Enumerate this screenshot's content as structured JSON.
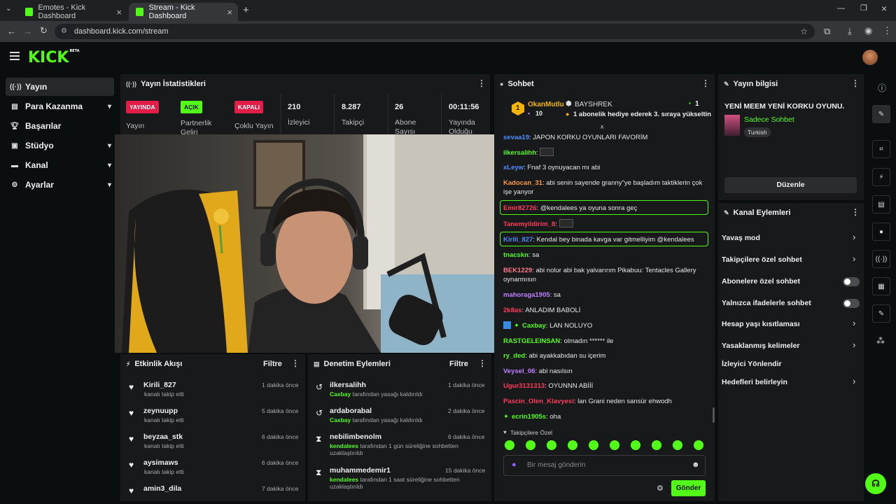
{
  "browser": {
    "tabs": [
      {
        "title": "Emotes - Kick Dashboard"
      },
      {
        "title": "Stream - Kick Dashboard"
      }
    ],
    "url": "dashboard.kick.com/stream"
  },
  "header": {
    "logo": "KICK",
    "logo_sup": "BETA"
  },
  "nav": [
    {
      "label": "Yayın",
      "icon": "broadcast-icon",
      "active": true
    },
    {
      "label": "Para Kazanma",
      "icon": "wallet-icon"
    },
    {
      "label": "Başarılar",
      "icon": "trophy-icon"
    },
    {
      "label": "Stüdyo",
      "icon": "studio-icon"
    },
    {
      "label": "Kanal",
      "icon": "channel-icon"
    },
    {
      "label": "Ayarlar",
      "icon": "gear-icon"
    }
  ],
  "stats": {
    "title": "Yayın İstatistikleri",
    "items": [
      {
        "badge": "YAYINDA",
        "label": "Yayın"
      },
      {
        "badge": "AÇIK",
        "label": "Partnerlik Geliri"
      },
      {
        "badge": "KAPALI",
        "label": "Çoklu Yayın"
      },
      {
        "value": "210",
        "label": "İzleyici"
      },
      {
        "value": "8.287",
        "label": "Takipçi"
      },
      {
        "value": "26",
        "label": "Abone Sayısı"
      },
      {
        "value": "00:11:56",
        "label": "Yayında Olduğu"
      }
    ]
  },
  "chat": {
    "title": "Sohbet",
    "pinned": {
      "user": "OkanMutlu",
      "count": "10",
      "channel": "BAYSHREK",
      "text": "1 abonelik hediye ederek 3. sıraya yükseltin",
      "rank": "1",
      "green_count": "1"
    },
    "messages": [
      {
        "user": "sevaa19",
        "color": "#4d8dff",
        "text": "JAPON KORKU OYUNLARI FAVORİM"
      },
      {
        "user": "ilkersalihh",
        "color": "#53fc18",
        "text": ""
      },
      {
        "user": "xLeyw",
        "color": "#4d8dff",
        "text": "Fnaf 3 oynuyacan mı abi"
      },
      {
        "user": "Kadocan_31",
        "color": "#ff9a3c",
        "text": "abi senin sayende granny\"ye başladım taktiklerin çok işe yanyor"
      },
      {
        "user": "Emir82726",
        "color": "#ff3b5b",
        "text": "@kendalees ya oyuna sonra geç"
      },
      {
        "user": "Tanemyildirim_8",
        "color": "#ff3b5b",
        "text": ""
      },
      {
        "user": "Kirili_827",
        "color": "#4d8dff",
        "text": "Kendal bey binada kavga var gitmelliyim @kendalees"
      },
      {
        "user": "tnacskn",
        "color": "#53fc18",
        "text": "sa"
      },
      {
        "user": "BEK1229",
        "color": "#ff7a8a",
        "text": "abi nolur abi bak yalvarırım Pikabuu: Tentacles Gallery oynarmısın"
      },
      {
        "user": "mahoraga1905",
        "color": "#c080ff",
        "text": "sa"
      },
      {
        "user": "2k8as",
        "color": "#ff3b5b",
        "text": "ANLADIM BABOLİ"
      },
      {
        "user": "Caxbay",
        "color": "#53fc18",
        "text": "LAN NOLUYO"
      },
      {
        "user": "RASTGELEINSAN",
        "color": "#53fc18",
        "text": "olmadın ****** ile"
      },
      {
        "user": "ry_ded",
        "color": "#53fc18",
        "text": "abi ayakkabıdan su içerim"
      },
      {
        "user": "Veysel_06",
        "color": "#c080ff",
        "text": "abi nasılsın"
      },
      {
        "user": "Ugur3131313",
        "color": "#ff3b5b",
        "text": "OYUNNN ABİİİ"
      },
      {
        "user": "Pascin_Olen_Klavyesi",
        "color": "#ff3b5b",
        "text": "lan Grani neden sansür ehwodh"
      },
      {
        "user": "ecrin1905s",
        "color": "#53fc18",
        "text": "oha"
      }
    ],
    "followers_only": "Takipçilere Özel",
    "placeholder": "Bir mesaj gönderin",
    "send": "Gönder"
  },
  "activity": {
    "title": "Etkinlik Akışı",
    "filter": "Filtre",
    "items": [
      {
        "name": "Kirili_827",
        "sub": "kanalı takip etti",
        "time": "1 dakika önce"
      },
      {
        "name": "zeynuupp",
        "sub": "kanalı takip etti",
        "time": "5 dakika önce"
      },
      {
        "name": "beyzaa_stk",
        "sub": "kanalı takip etti",
        "time": "6 dakika önce"
      },
      {
        "name": "aysimaws",
        "sub": "kanalı takip etti",
        "time": "6 dakika önce"
      },
      {
        "name": "amin3_dila",
        "sub": "",
        "time": "7 dakika önce"
      }
    ]
  },
  "moderation": {
    "title": "Denetim Eylemleri",
    "filter": "Filtre",
    "items": [
      {
        "name": "ilkersalihh",
        "by": "Caxbay",
        "sub": "tarafından yasağı kaldırıldı",
        "time": "1 dakika önce",
        "icon": "undo-icon"
      },
      {
        "name": "ardaborabal",
        "by": "Caxbay",
        "sub": "tarafından yasağı kaldırıldı",
        "time": "2 dakika önce",
        "icon": "undo-icon"
      },
      {
        "name": "nebilimbenolm",
        "by": "kendalees",
        "sub": "tarafından 1 gün süreliğine sohbetten uzaklaştırıldı",
        "time": "6 dakika önce",
        "icon": "hourglass-icon"
      },
      {
        "name": "muhammedemir1",
        "by": "kendalees",
        "sub": "tarafından 1 saat süreliğine sohbetten uzaklaştırıldı",
        "time": "15 dakika önce",
        "icon": "hourglass-icon"
      }
    ]
  },
  "stream_info": {
    "title": "Yayın bilgisi",
    "stream_title": "YENİ MEEM YENİ KORKU OYUNU.",
    "category": "Sadece Sohbet",
    "language": "Turkish",
    "edit": "Düzenle"
  },
  "channel_actions": {
    "title": "Kanal Eylemleri",
    "items": [
      {
        "label": "Yavaş mod",
        "type": "chevron"
      },
      {
        "label": "Takipçilere özel sohbet",
        "type": "chevron"
      },
      {
        "label": "Abonelere özel sohbet",
        "type": "toggle"
      },
      {
        "label": "Yalnızca ifadelerle sohbet",
        "type": "toggle"
      },
      {
        "label": "Hesap yaşı kısıtlaması",
        "type": "chevron"
      },
      {
        "label": "Yasaklanmış kelimeler",
        "type": "chevron"
      },
      {
        "label": "İzleyici Yönlendir",
        "type": "none"
      },
      {
        "label": "Hedefleri belirleyin",
        "type": "chevron"
      }
    ]
  },
  "colors": {
    "accent": "#53fc18",
    "live": "#e11d48",
    "panel": "#17191b",
    "bg": "#0b0e0f"
  }
}
